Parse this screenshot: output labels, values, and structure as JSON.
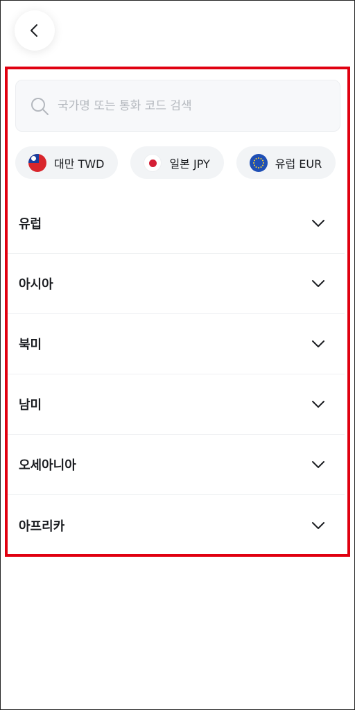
{
  "header": {
    "back_icon": "chevron-left-icon"
  },
  "search": {
    "placeholder": "국가명 또는 통화 코드 검색",
    "value": "",
    "icon": "search-icon"
  },
  "quick_chips": [
    {
      "label": "대만 TWD",
      "flag": "taiwan-flag"
    },
    {
      "label": "일본 JPY",
      "flag": "japan-flag"
    },
    {
      "label": "유럽 EUR",
      "flag": "eu-flag"
    }
  ],
  "regions": [
    {
      "label": "유럽"
    },
    {
      "label": "아시아"
    },
    {
      "label": "북미"
    },
    {
      "label": "남미"
    },
    {
      "label": "오세아니아"
    },
    {
      "label": "아프리카"
    }
  ],
  "colors": {
    "highlight": "#e00010",
    "chip_bg": "#f2f4f6",
    "search_bg": "#f7f8fa",
    "text": "#1b1d21"
  }
}
